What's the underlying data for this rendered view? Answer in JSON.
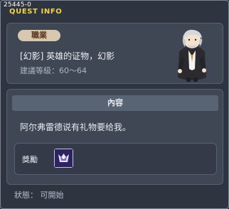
{
  "quest": {
    "id": "25445-0",
    "window_title": "QUEST INFO"
  },
  "job": {
    "badge_label": "職業",
    "title": "[幻影] 英雄的证物，幻影",
    "level": "建議等級：60～64"
  },
  "content": {
    "header": "內容",
    "description": "阿尔弗雷德说有礼物要给我。",
    "reward_label": "獎勵",
    "reward_item_icon": "phantom-emblem-icon"
  },
  "status": {
    "text": "狀態： 可開始"
  },
  "icons": {
    "portrait": "alfred-npc-portrait"
  },
  "colors": {
    "title": "#f2d24a",
    "badge_bg": "#d8c8b2",
    "panel_bg": "#3f4654"
  }
}
